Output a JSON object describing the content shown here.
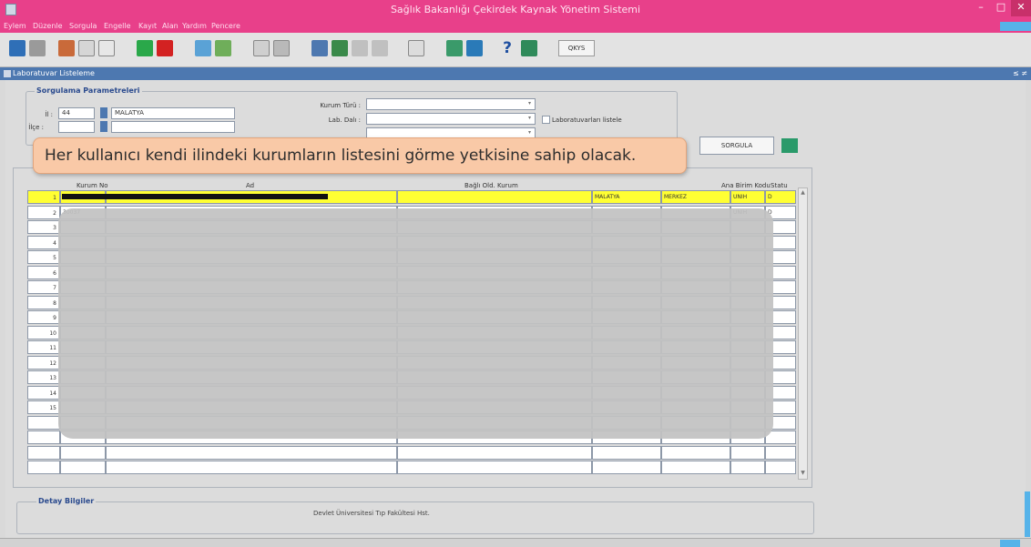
{
  "window": {
    "title": "Sağlık Bakanlığı Çekirdek Kaynak Yönetim Sistemi"
  },
  "menu": [
    "Eylem",
    "Düzenle",
    "Sorgula",
    "Engelle",
    "Kayıt",
    "Alan",
    "Yardım",
    "Pencere"
  ],
  "toolbar": {
    "qkys_label": "QKYS"
  },
  "inner_window": {
    "title": "Laboratuvar Listeleme"
  },
  "query": {
    "group_title": "Sorgulama Parametreleri",
    "il_label": "İl :",
    "il_code": "44",
    "il_name": "MALATYA",
    "ilce_label": "İlçe :",
    "ilce_code": "",
    "ilce_name": "",
    "kurum_turu_label": "Kurum Türü :",
    "lab_dal_label": "Lab. Dalı :",
    "lab_checkbox_label": "Laboratuvarları listele",
    "sorgula_label": "SORGULA"
  },
  "banner": {
    "text": "Her kullanıcı kendi ilindeki kurumların listesini görme yetkisine sahip olacak."
  },
  "table": {
    "headers": {
      "kurum_no": "Kurum No",
      "ad": "Ad",
      "bagli": "Bağlı Old. Kurum",
      "ana_birim": "Ana Birim Kodu",
      "statu": "Statu"
    },
    "rows": [
      {
        "num": "1",
        "kurum_no": "",
        "ad": "",
        "bagli": "",
        "il": "MALATYA",
        "ilce": "MERKEZ",
        "tip": "UNIH",
        "statu": "D"
      },
      {
        "num": "2",
        "kurum_no": "30037",
        "ad": "",
        "bagli": "",
        "il": "",
        "ilce": "",
        "tip": "UNIH",
        "statu": "D"
      },
      {
        "num": "3",
        "kurum_no": "",
        "ad": "",
        "bagli": "",
        "il": "",
        "ilce": "",
        "tip": "",
        "statu": ""
      },
      {
        "num": "4"
      },
      {
        "num": "5"
      },
      {
        "num": "6"
      },
      {
        "num": "7"
      },
      {
        "num": "8"
      },
      {
        "num": "9"
      },
      {
        "num": "10"
      },
      {
        "num": "11"
      },
      {
        "num": "12"
      },
      {
        "num": "13"
      },
      {
        "num": "14"
      },
      {
        "num": "15"
      },
      {
        "num": ""
      },
      {
        "num": ""
      },
      {
        "num": ""
      },
      {
        "num": ""
      }
    ]
  },
  "detail": {
    "group_title": "Detay Bilgiler",
    "text": "Devlet Üniversitesi Tıp Fakültesi Hst."
  },
  "colors": {
    "title_bar": "#e8408a",
    "selected_row": "#ffff33",
    "banner_bg": "#f9c9a7"
  }
}
